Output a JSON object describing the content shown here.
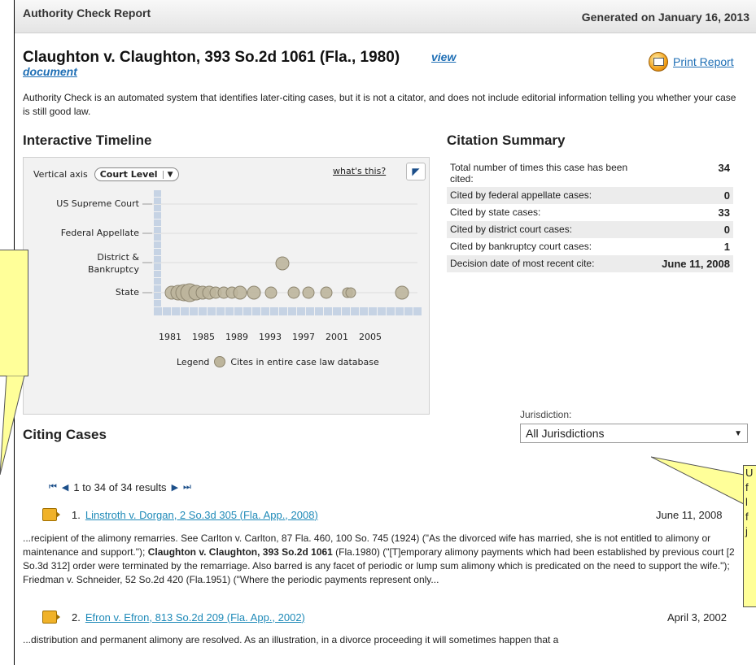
{
  "header": {
    "title": "Authority Check Report",
    "generated": "Generated on January 16, 2013"
  },
  "case": {
    "title": "Claughton v. Claughton, 393 So.2d 1061 (Fla., 1980)",
    "view_link_1": "view",
    "view_link_2": "document",
    "print_label": "Print Report"
  },
  "intro": "Authority Check is an automated system that identifies later-citing cases, but it is not a citator, and does not include editorial information telling you whether your case is still good law.",
  "timeline": {
    "heading": "Interactive Timeline",
    "vertical_axis_label": "Vertical axis",
    "axis_select": "Court Level",
    "whats_this": "what's this?",
    "levels": [
      "US Supreme Court",
      "Federal Appellate",
      "District &",
      "Bankruptcy",
      "State"
    ],
    "x_ticks": [
      "1981",
      "1985",
      "1989",
      "1993",
      "1997",
      "2001",
      "2005"
    ],
    "legend_label": "Legend",
    "legend_text": "Cites in entire case law database",
    "colors": {
      "bubble": "#bdb59c",
      "axis": "#c6d3e4"
    }
  },
  "summary": {
    "heading": "Citation Summary",
    "rows": [
      {
        "label": "Total number of times this case has been cited:",
        "value": "34"
      },
      {
        "label": "Cited by federal appellate cases:",
        "value": "0"
      },
      {
        "label": "Cited by state cases:",
        "value": "33"
      },
      {
        "label": "Cited by district court cases:",
        "value": "0"
      },
      {
        "label": "Cited by bankruptcy court cases:",
        "value": "1"
      },
      {
        "label": "Decision date of most recent cite:",
        "value": "June 11, 2008"
      }
    ]
  },
  "citing": {
    "heading": "Citing Cases",
    "jurisdiction_label": "Jurisdiction:",
    "jurisdiction_value": "All Jurisdictions",
    "results": "1 to 34 of 34 results",
    "cases": [
      {
        "num": "1.",
        "name": "Linstroth v. Dorgan, 2 So.3d 305 (Fla. App., 2008)",
        "date": "June 11, 2008",
        "snippet_pre": "...recipient of the alimony remarries. See Carlton v. Carlton, 87 Fla. 460, 100 So. 745 (1924) (\"As the divorced wife has married, she is not entitled to alimony or maintenance and support.\"); ",
        "snippet_bold": "Claughton v. Claughton, 393 So.2d 1061",
        "snippet_post": " (Fla.1980) (\"[T]emporary alimony payments which had been established by previous court [2 So.3d 312] order were terminated by the remarriage. Also barred is any facet of periodic or lump sum alimony which is predicated on the need to support the wife.\"); Friedman v. Schneider, 52 So.2d 420 (Fla.1951) (\"Where the periodic payments represent only..."
      },
      {
        "num": "2.",
        "name": "Efron v. Efron, 813 So.2d 209 (Fla. App., 2002)",
        "date": "April 3, 2002",
        "snippet_pre": "...distribution and permanent alimony are resolved. As an illustration, in a divorce proceeding it will sometimes happen that a"
      }
    ]
  },
  "callout_right_lines": [
    "U",
    "f",
    "l",
    "f",
    "j"
  ]
}
